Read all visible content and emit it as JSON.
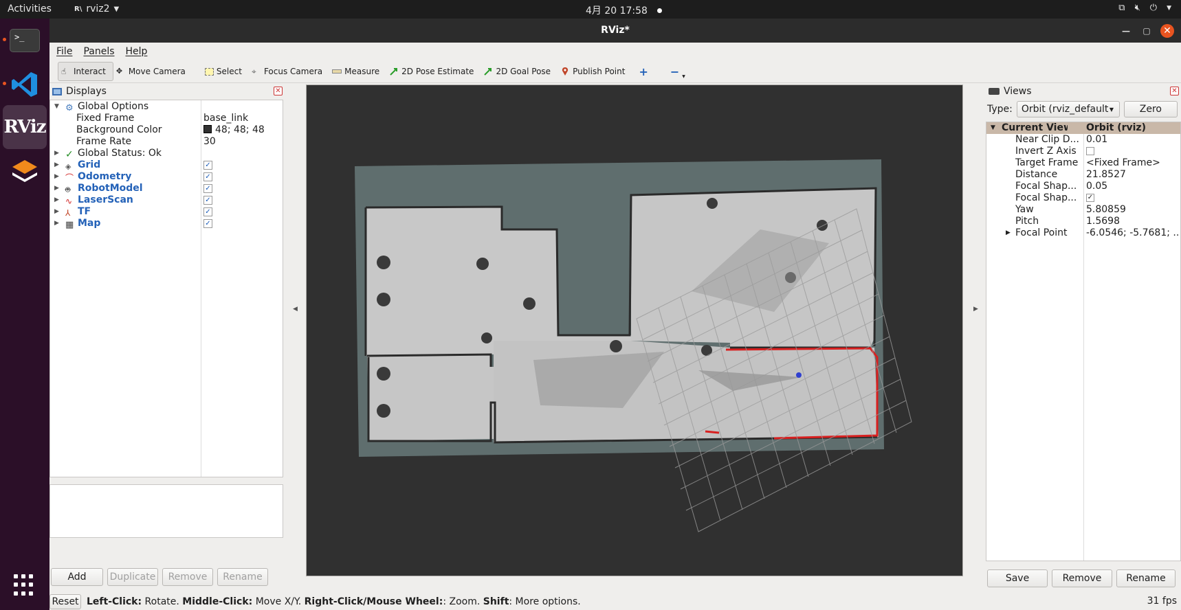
{
  "topbar": {
    "activities": "Activities",
    "app_name": "rviz2",
    "clock": "4月 20  17:58"
  },
  "dock": {
    "items": [
      "terminal-icon",
      "vscode-icon",
      "rviz-icon",
      "layers-app-icon"
    ],
    "rviz_text": "RViz"
  },
  "window": {
    "title": "RViz*"
  },
  "menu": {
    "items": [
      "File",
      "Panels",
      "Help"
    ]
  },
  "toolbar": {
    "tools": [
      {
        "label": "Interact",
        "icon": "hand-cursor-icon"
      },
      {
        "label": "Move Camera",
        "icon": "move-camera-icon"
      },
      {
        "label": "Select",
        "icon": "select-box-icon"
      },
      {
        "label": "Focus Camera",
        "icon": "focus-camera-icon"
      },
      {
        "label": "Measure",
        "icon": "ruler-icon"
      },
      {
        "label": "2D Pose Estimate",
        "icon": "green-arrow-icon"
      },
      {
        "label": "2D Goal Pose",
        "icon": "green-arrow-icon"
      },
      {
        "label": "Publish Point",
        "icon": "map-pin-icon"
      }
    ]
  },
  "displays": {
    "title": "Displays",
    "global_options": "Global Options",
    "props": [
      {
        "name": "Fixed Frame",
        "value": "base_link"
      },
      {
        "name": "Background Color",
        "value": "48; 48; 48"
      },
      {
        "name": "Frame Rate",
        "value": "30"
      }
    ],
    "global_status": "Global Status: Ok",
    "items": [
      "Grid",
      "Odometry",
      "RobotModel",
      "LaserScan",
      "TF",
      "Map"
    ],
    "buttons": {
      "add": "Add",
      "duplicate": "Duplicate",
      "remove": "Remove",
      "rename": "Rename"
    }
  },
  "views": {
    "title": "Views",
    "type_label": "Type:",
    "type_value": "Orbit (rviz_default",
    "zero": "Zero",
    "header": {
      "name": "Current View",
      "value": "Orbit (rviz)"
    },
    "props": [
      {
        "name": "Near Clip D...",
        "value": "0.01"
      },
      {
        "name": "Invert Z Axis",
        "value": ""
      },
      {
        "name": "Target Frame",
        "value": "<Fixed Frame>"
      },
      {
        "name": "Distance",
        "value": "21.8527"
      },
      {
        "name": "Focal Shap...",
        "value": "0.05"
      },
      {
        "name": "Focal Shap...",
        "value": ""
      },
      {
        "name": "Yaw",
        "value": "5.80859"
      },
      {
        "name": "Pitch",
        "value": "1.5698"
      },
      {
        "name": "Focal Point",
        "value": "-6.0546; -5.7681; ..."
      }
    ],
    "buttons": {
      "save": "Save",
      "remove": "Remove",
      "rename": "Rename"
    }
  },
  "statusbar": {
    "reset": "Reset",
    "h1": "Left-Click:",
    "t1": " Rotate. ",
    "h2": "Middle-Click:",
    "t2": " Move X/Y. ",
    "h3": "Right-Click/Mouse Wheel:",
    "t3": ": Zoom. ",
    "h4": "Shift",
    "t4": ": More options.",
    "fps": "31 fps"
  },
  "colors": {
    "accent": "#e95420",
    "map_background": "#303030",
    "unknown_space": "#5f6e6e",
    "free_space": "#c7c7c7",
    "laser": "#e02020"
  }
}
